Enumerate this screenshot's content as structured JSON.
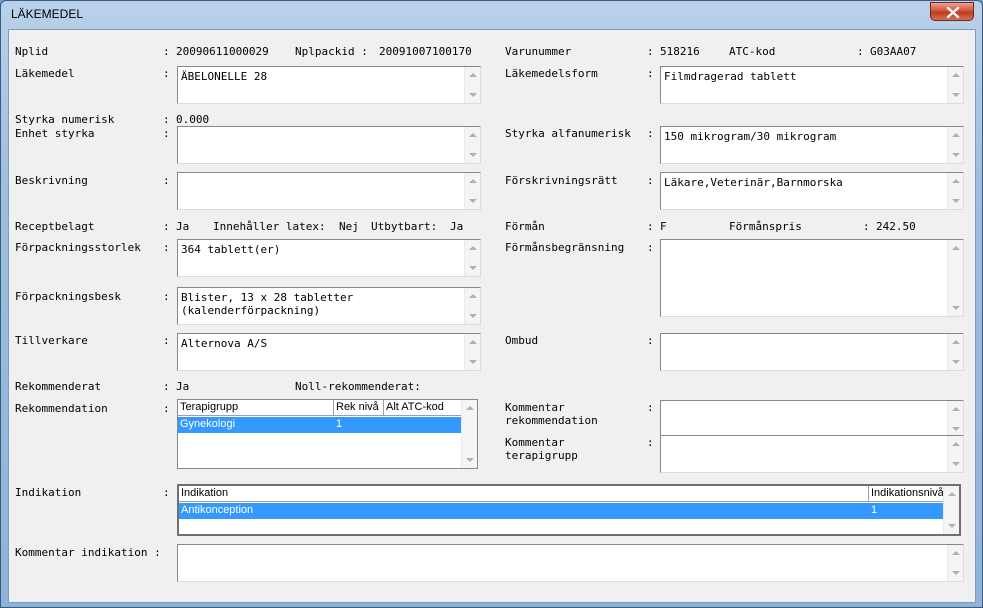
{
  "window": {
    "title": "LÄKEMEDEL"
  },
  "fields": {
    "nplid_label": "Nplid",
    "nplid_colon": ":",
    "nplid_value": "20090611000029",
    "nplpackid_label": "Nplpackid :",
    "nplpackid_value": "20091007100170",
    "varunummer_label": "Varunummer",
    "varunummer_colon": ":",
    "varunummer_value": "518216",
    "atckod_label": "ATC-kod",
    "atckod_colon": ":",
    "atckod_value": "G03AA07",
    "lakemedel_label": "Läkemedel",
    "lakemedel_colon": ":",
    "lakemedel_value": "ÄBELONELLE 28",
    "lakemedelsform_label": "Läkemedelsform",
    "lakemedelsform_colon": ":",
    "lakemedelsform_value": "Filmdragerad tablett",
    "styrka_num_label": "Styrka numerisk",
    "styrka_num_colon": ":",
    "styrka_num_value": "0.000",
    "enhet_styrka_label": "Enhet styrka",
    "enhet_styrka_colon": ":",
    "enhet_styrka_value": "",
    "styrka_alfa_label": "Styrka alfanumerisk",
    "styrka_alfa_colon": ":",
    "styrka_alfa_value": "150 mikrogram/30 mikrogram",
    "beskrivning_label": "Beskrivning",
    "beskrivning_colon": ":",
    "beskrivning_value": "",
    "forskrivning_label": "Förskrivningsrätt",
    "forskrivning_colon": ":",
    "forskrivning_value": "Läkare,Veterinär,Barnmorska",
    "receptbelagt_label": "Receptbelagt",
    "receptbelagt_colon": ":",
    "receptbelagt_value": "Ja",
    "latex_label": "Innehåller latex:",
    "latex_value": "Nej",
    "utbytbart_label": "Utbytbart:",
    "utbytbart_value": "Ja",
    "forman_label": "Förmån",
    "forman_colon": ":",
    "forman_value": "F",
    "formanspris_label": "Förmånspris",
    "formanspris_colon": ":",
    "formanspris_value": "242.50",
    "forp_storlek_label": "Förpackningsstorlek",
    "forp_storlek_colon": ":",
    "forp_storlek_value": "364 tablett(er)",
    "formansbegr_label": "Förmånsbegränsning",
    "formansbegr_colon": ":",
    "formansbegr_value": "",
    "forp_besk_label": "Förpackningsbesk",
    "forp_besk_colon": ":",
    "forp_besk_value": "Blister, 13 x 28 tabletter\n(kalenderförpackning)",
    "tillverkare_label": "Tillverkare",
    "tillverkare_colon": ":",
    "tillverkare_value": "Alternova A/S",
    "ombud_label": "Ombud",
    "ombud_colon": ":",
    "ombud_value": "",
    "rekommenderat_label": "Rekommenderat",
    "rekommenderat_colon": ":",
    "rekommenderat_value": "Ja",
    "noll_rek_label": "Noll-rekommenderat:",
    "rekommendation_label": "Rekommendation",
    "rekommendation_colon": ":",
    "kommentar_rek_label": "Kommentar\nrekommendation",
    "kommentar_rek_colon": ":",
    "kommentar_terapi_label": "Kommentar\nterapigrupp",
    "kommentar_terapi_colon": ":",
    "indikation_label": "Indikation",
    "indikation_colon": ":",
    "kommentar_ind_label": "Kommentar indikation :"
  },
  "rek_table": {
    "headers": [
      "Terapigrupp",
      "Rek nivå",
      "Alt ATC-kod"
    ],
    "rows": [
      [
        "Gynekologi",
        "1",
        ""
      ]
    ]
  },
  "ind_table": {
    "headers": [
      "Indikation",
      "Indikationsnivå"
    ],
    "rows": [
      [
        "Antikonception",
        "1"
      ]
    ]
  }
}
